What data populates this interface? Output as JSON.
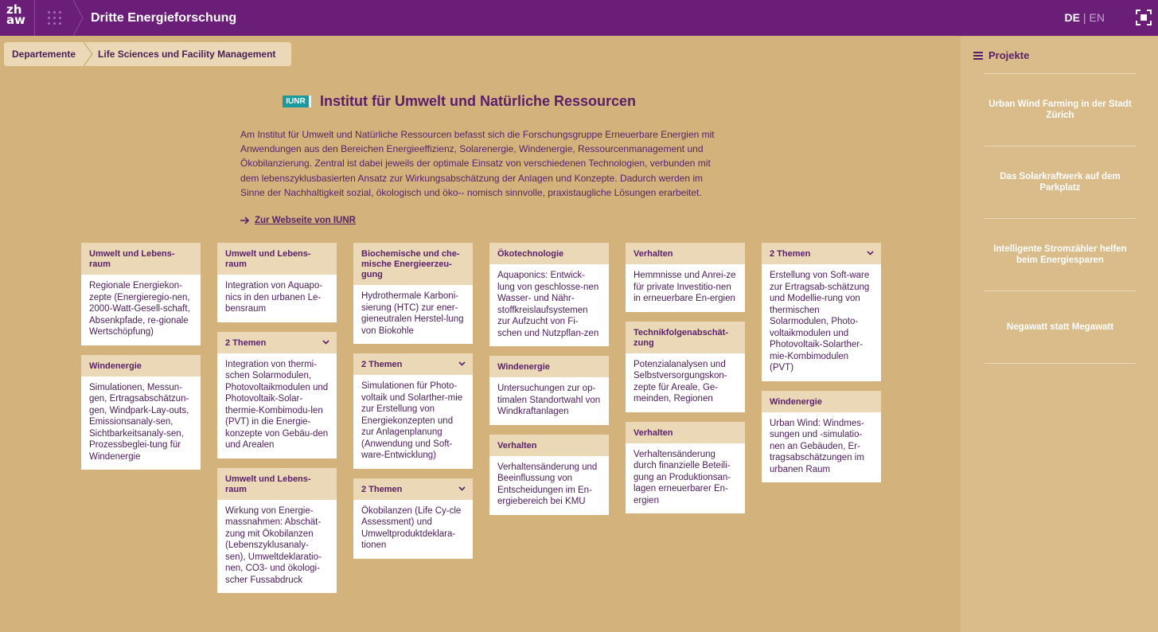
{
  "header": {
    "logo": "zh aw",
    "title": "Dritte Energieforschung",
    "lang_de": "DE",
    "lang_sep": "|",
    "lang_en": "EN"
  },
  "breadcrumb": [
    "Departemente",
    "Life Sciences und Facility Management"
  ],
  "institute": {
    "logo": "IUNR",
    "title": "Institut für Umwelt und Natürliche Ressourcen",
    "description": "Am Institut für Umwelt und Natürliche Ressourcen befasst sich die Forschungsgruppe Erneuerbare Energien mit Anwendungen aus den Bereichen Energieeffizienz, Solarenergie, Windenergie, Ressourcenmanagement und Ökobilanzierung. Zentral ist dabei jeweils der optimale Einsatz von verschiedenen Technologien, verbunden mit dem lebenszyklusbasierten Ansatz zur Wirkungsabschätzung der Anlagen und Konzepte. Dadurch werden im Sinne der Nachhaltigkeit sozial, ökologisch und öko-- nomisch sinnvolle, praxistaugliche Lösungen erarbeitet.",
    "link": "Zur Webseite von IUNR"
  },
  "columns": [
    [
      {
        "head": "Umwelt und Lebens-raum",
        "body": "Regionale Energiekon-zepte (Energieregio-nen, 2000-Watt-Gesell-schaft, Absenkpfade, re-gionale Wertschöpfung)"
      },
      {
        "head": "Windenergie",
        "body": "Simulationen, Messun-gen, Ertragsabschätzun-gen, Windpark-Lay-outs, Emissionsanaly-sen, Sichtbarkeitsanaly-sen, Prozessbeglei-tung für Windenergie"
      }
    ],
    [
      {
        "head": "Umwelt und Lebens-raum",
        "body": "Integration von Aquapo-nics in den urbanen Le-bensraum"
      },
      {
        "head": "2 Themen",
        "themes": true,
        "body": "Integration von thermi-schen Solarmodulen, Photovoltaikmodulen und Photovoltaik-Solar-thermie-Kombimodu-len (PVT) in die Energie-konzepte von Gebäu-den und Arealen"
      },
      {
        "head": "Umwelt und Lebens-raum",
        "body": "Wirkung von Energie-massnahmen: Abschät-zung mit Ökobilanzen (Lebenszyklusanaly-sen), Umweltdeklaratio-nen, CO3- und ökologi-scher Fussabdruck"
      }
    ],
    [
      {
        "head": "Biochemische und che-mische Energieerzeu-gung",
        "body": "Hydrothermale Karboni-sierung (HTC) zur ener-gieneutralen Herstel-lung von Biokohle"
      },
      {
        "head": "2 Themen",
        "themes": true,
        "body": "Simulationen für Photo-voltaik und Solarther-mie zur Erstellung von Energiekonzepten und zur Anlagenplanung (Anwendung und Soft-ware-Entwicklung)"
      },
      {
        "head": "2 Themen",
        "themes": true,
        "body": "Ökobilanzen (Life Cy-cle Assessment) und Umweltproduktdeklara-tionen"
      }
    ],
    [
      {
        "head": "Ökotechnologie",
        "body": "Aquaponics: Entwick-lung von geschlosse-nen Wasser- und Nähr-stoffkreislaufsystemen zur Aufzucht von Fi-schen und Nutzpflan-zen"
      },
      {
        "head": "Windenergie",
        "body": "Untersuchungen zur op-timalen Standortwahl von Windkraftanlagen"
      },
      {
        "head": "Verhalten",
        "body": "Verhaltensänderung und Beeinflussung von Entscheidungen im En-ergiebereich bei KMU"
      }
    ],
    [
      {
        "head": "Verhalten",
        "body": "Hemmnisse und Anrei-ze für private Investitio-nen in erneuerbare En-ergien"
      },
      {
        "head": "Technikfolgenabschät-zung",
        "body": "Potenzialanalysen und Selbstversorgungskon-zepte für Areale, Ge-meinden, Regionen"
      },
      {
        "head": "Verhalten",
        "body": "Verhaltensänderung durch finanzielle Beteili-gung an Produktionsan-lagen erneuerbarer En-ergien"
      }
    ],
    [
      {
        "head": "2 Themen",
        "themes": true,
        "body": "Erstellung von Soft-ware zur Ertragsab-schätzung und Modellie-rung von thermischen Solarmodulen, Photo-voltaikmodulen und Photovoltaik-Solarther-mie-Kombimodulen (PVT)"
      },
      {
        "head": "Windenergie",
        "body": "Urban Wind: Windmes-sungen und -simulatio-nen an Gebäuden, Er-tragsabschätzungen im urbanen Raum"
      }
    ]
  ],
  "sidebar": {
    "title": "Projekte",
    "projects": [
      "Urban Wind Farming in der Stadt Zürich",
      "Das Solarkraftwerk auf dem Parkplatz",
      "Intelligente Stromzähler helfen beim Energiesparen",
      "Negawatt statt Megawatt"
    ]
  }
}
